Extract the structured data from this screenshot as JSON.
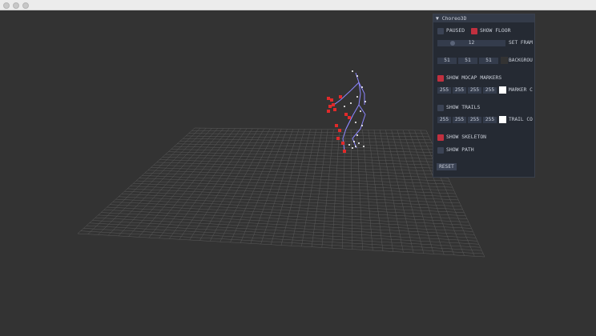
{
  "panel": {
    "title": "Choreo3D",
    "paused_label": "PAUSED",
    "paused_checked": false,
    "show_floor_label": "SHOW FLOOR",
    "show_floor_checked": true,
    "frame_value": "12",
    "set_frame_label": "SET FRAM",
    "background_values": [
      "51",
      "51",
      "51"
    ],
    "background_label": "BACKGROU",
    "show_mocap_label": "SHOW MOCAP MARKERS",
    "show_mocap_checked": true,
    "marker_color_values": [
      "255",
      "255",
      "255",
      "255"
    ],
    "marker_color_label": "MARKER C",
    "show_trails_label": "SHOW TRAILS",
    "show_trails_checked": false,
    "trail_color_values": [
      "255",
      "255",
      "255",
      "255"
    ],
    "trail_color_label": "TRAIL CO",
    "show_skeleton_label": "SHOW SKELETON",
    "show_skeleton_checked": true,
    "show_path_label": "SHOW PATH",
    "show_path_checked": false,
    "reset_label": "RESET"
  },
  "colors": {
    "viewport_bg": "#333333",
    "checkbox_on": "#c0303f",
    "checkbox_off": "#3b4354",
    "skeleton": "#8c86ff",
    "marker_red": "#e02a2a",
    "grid": "#5a5a5a"
  },
  "icons": {
    "collapse": "triangle-down-icon"
  }
}
